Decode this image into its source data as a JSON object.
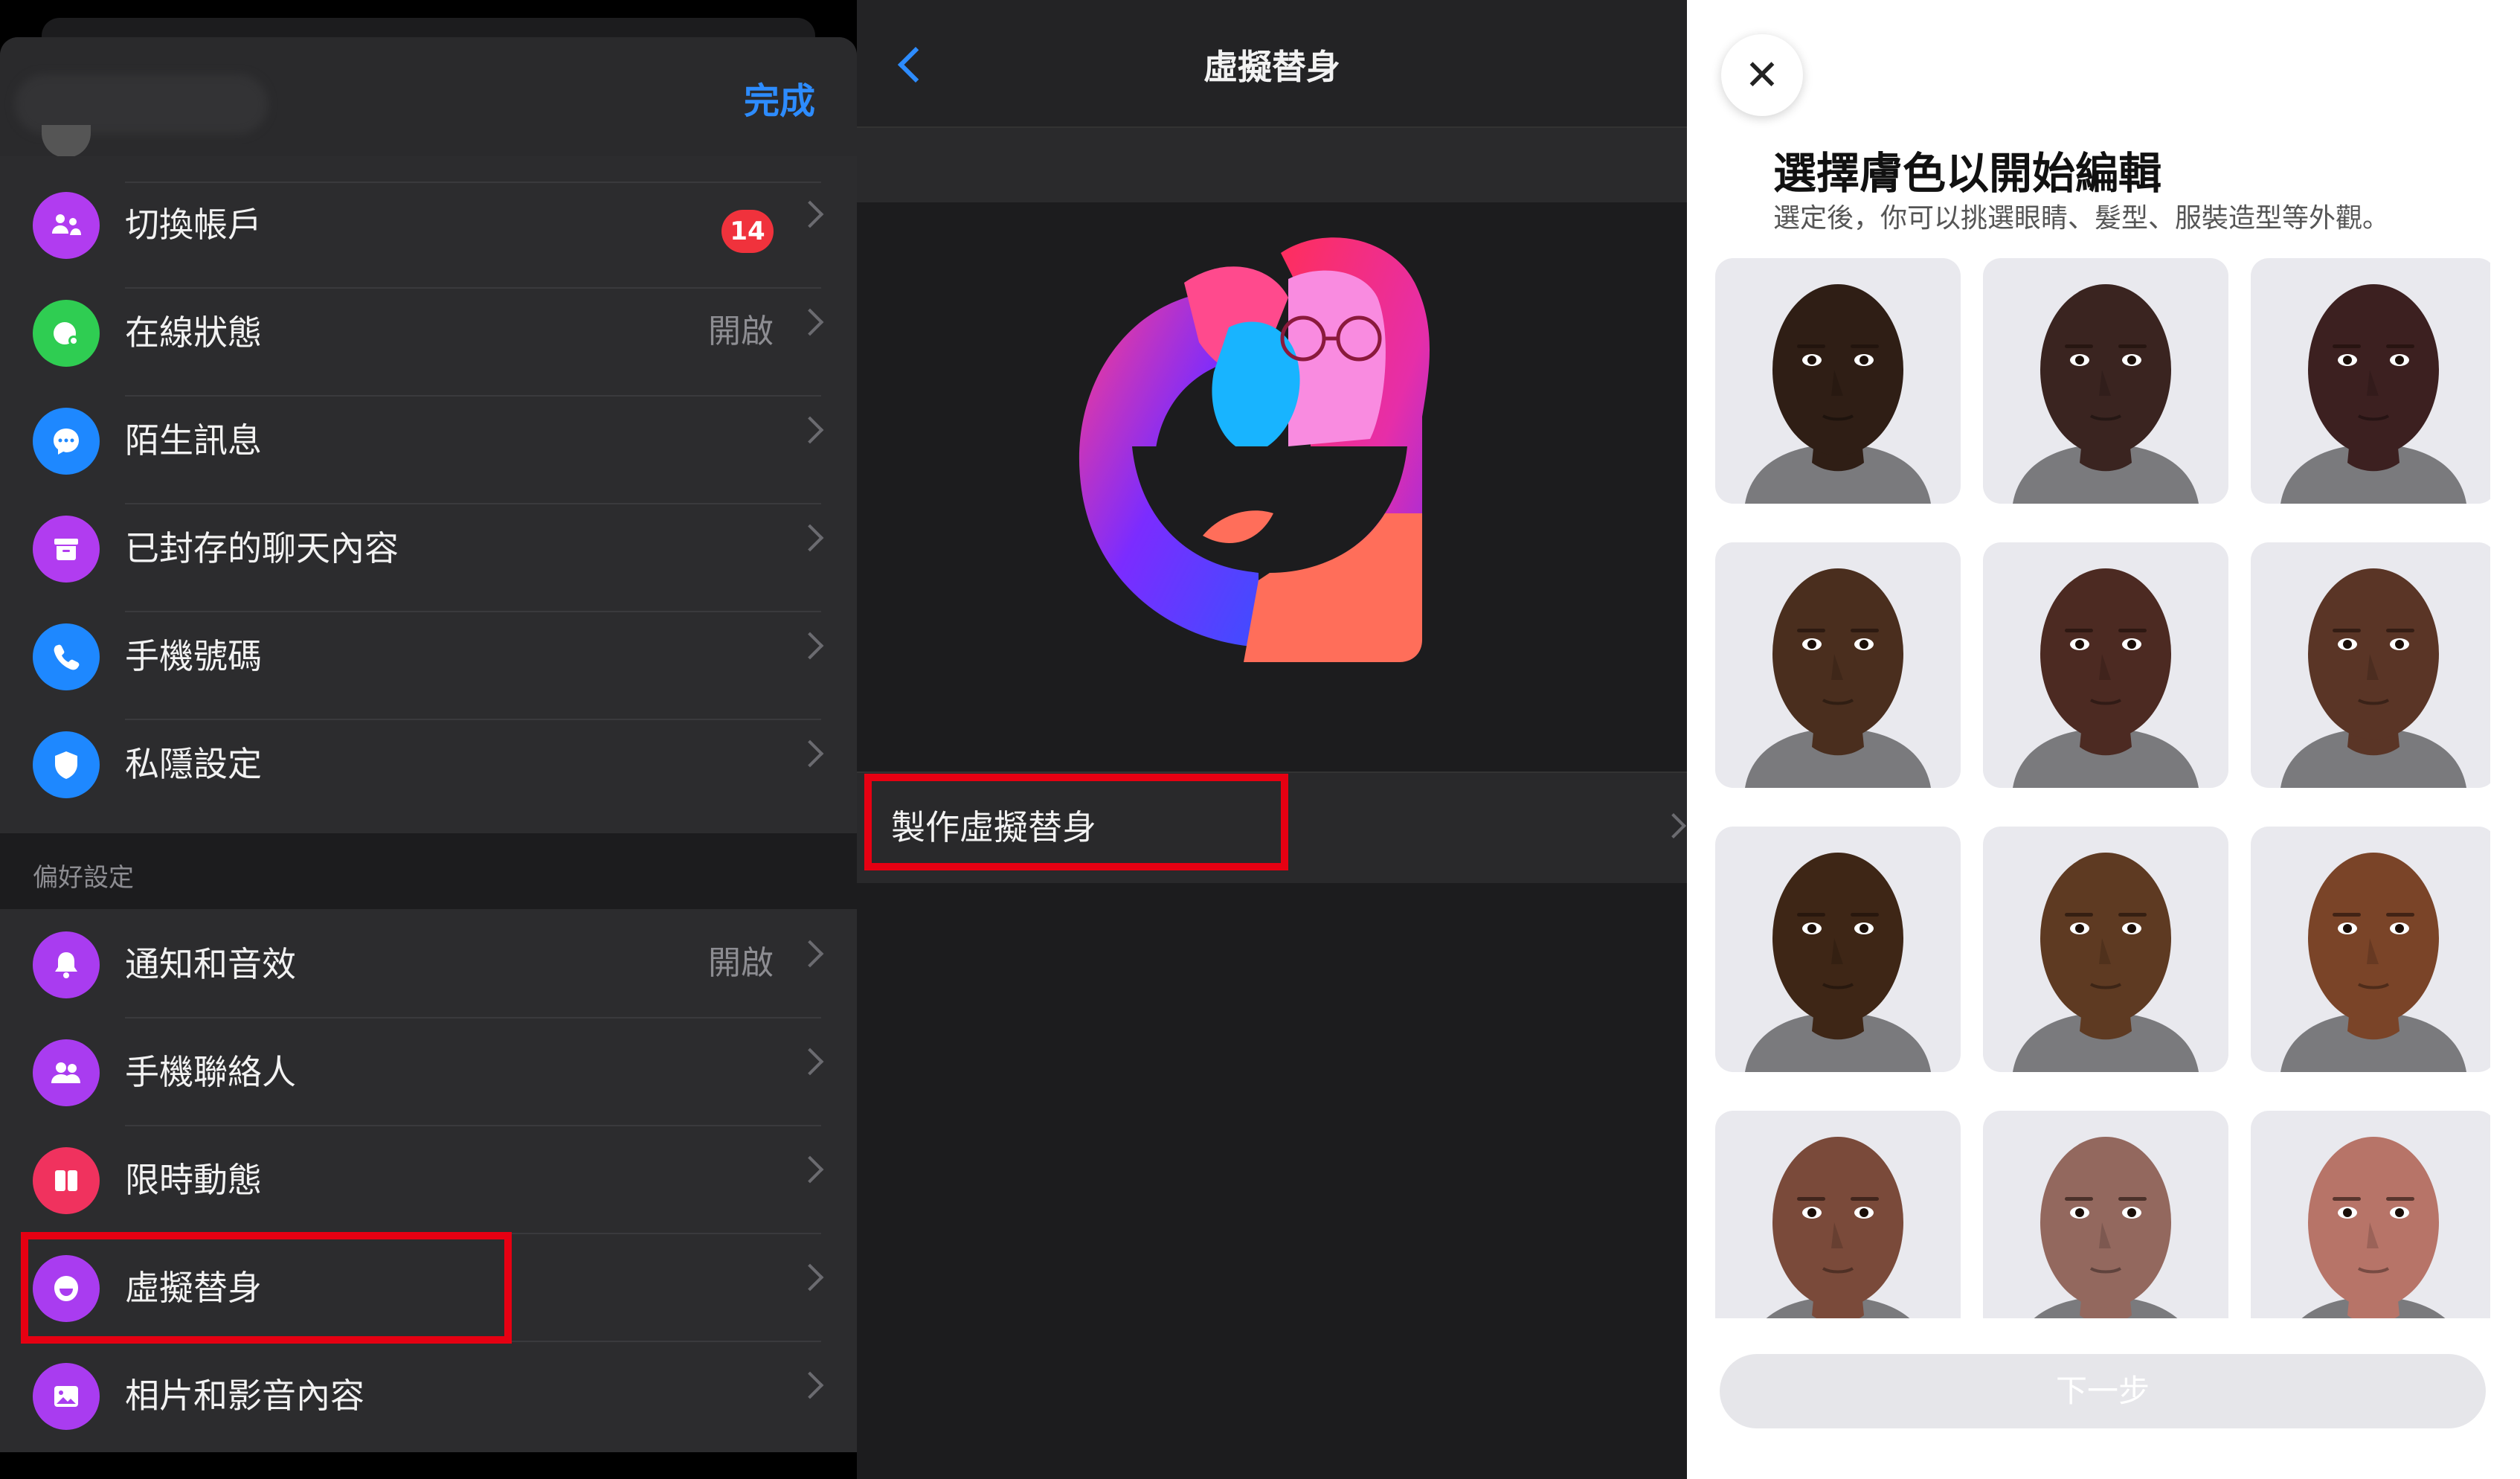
{
  "settings_panel": {
    "done_label": "完成",
    "account_items": [
      {
        "key": "switch-account",
        "label": "切換帳戶",
        "badge": "14",
        "value": "",
        "icon": "switch-account-icon",
        "icon_color": "#b13cf0"
      },
      {
        "key": "active-status",
        "label": "在線狀態",
        "badge": "",
        "value": "開啟",
        "icon": "active-status-icon",
        "icon_color": "#2fcd52"
      },
      {
        "key": "message-requests",
        "label": "陌生訊息",
        "badge": "",
        "value": "",
        "icon": "chat-bubble-icon",
        "icon_color": "#1e88ff"
      },
      {
        "key": "archived-chats",
        "label": "已封存的聊天內容",
        "badge": "",
        "value": "",
        "icon": "archive-icon",
        "icon_color": "#b13cf0"
      },
      {
        "key": "phone-number",
        "label": "手機號碼",
        "badge": "",
        "value": "",
        "icon": "phone-icon",
        "icon_color": "#1e88ff"
      },
      {
        "key": "privacy",
        "label": "私隱設定",
        "badge": "",
        "value": "",
        "icon": "shield-icon",
        "icon_color": "#1e88ff"
      }
    ],
    "preferences_title": "偏好設定",
    "preference_items": [
      {
        "key": "notifications",
        "label": "通知和音效",
        "value": "開啟",
        "icon": "bell-icon",
        "icon_color": "#a93cf0"
      },
      {
        "key": "phone-contacts",
        "label": "手機聯絡人",
        "value": "",
        "icon": "people-icon",
        "icon_color": "#a93cf0"
      },
      {
        "key": "stories",
        "label": "限時動態",
        "value": "",
        "icon": "stories-icon",
        "icon_color": "#f0325e"
      },
      {
        "key": "avatar",
        "label": "虛擬替身",
        "value": "",
        "icon": "avatar-face-icon",
        "icon_color": "#a93cf0"
      },
      {
        "key": "photos-media",
        "label": "相片和影音內容",
        "value": "",
        "icon": "photo-icon",
        "icon_color": "#a93cf0"
      }
    ]
  },
  "avatar_panel": {
    "title": "虛擬替身",
    "create_label": "製作虛擬替身"
  },
  "skin_panel": {
    "heading": "選擇膚色以開始編輯",
    "subheading": "選定後，你可以挑選眼睛、髮型、服裝造型等外觀。",
    "skin_tones": [
      "#2f1e15",
      "#3a2420",
      "#3c2020",
      "#4a2e1e",
      "#4c2a22",
      "#5a3526",
      "#3e2616",
      "#5e3a22",
      "#7a4428",
      "#7a4a3a",
      "#93685e",
      "#b77468"
    ],
    "next_label": "下一步"
  }
}
